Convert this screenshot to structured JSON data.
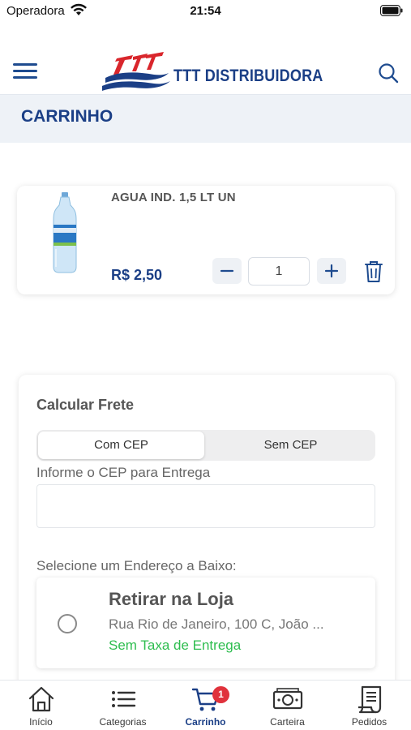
{
  "status_bar": {
    "carrier": "Operadora",
    "time": "21:54"
  },
  "header": {
    "brand": "TTT DISTRIBUIDORA",
    "logo_icon": "ttt-logo-icon",
    "menu_icon": "hamburger-menu-icon",
    "search_icon": "search-icon"
  },
  "page": {
    "title": "CARRINHO"
  },
  "cart": {
    "items": [
      {
        "name": "AGUA IND. 1,5 LT UN",
        "price": "R$ 2,50",
        "quantity": "1"
      }
    ]
  },
  "shipping": {
    "title": "Calcular Frete",
    "tabs": [
      "Com CEP",
      "Sem CEP"
    ],
    "selected_tab": "Com CEP",
    "cep_label": "Informe o CEP para Entrega",
    "cep_value": "",
    "address_label": "Selecione um Endereço a Baixo:",
    "address_option": {
      "title": "Retirar na Loja",
      "street": "Rua Rio de Janeiro, 100 C, João ...",
      "fee": "Sem Taxa de Entrega"
    }
  },
  "tabbar": {
    "items": [
      {
        "label": "Início",
        "icon": "home-icon"
      },
      {
        "label": "Categorias",
        "icon": "list-icon"
      },
      {
        "label": "Carrinho",
        "icon": "cart-icon",
        "badge": "1"
      },
      {
        "label": "Carteira",
        "icon": "wallet-icon"
      },
      {
        "label": "Pedidos",
        "icon": "receipt-icon"
      }
    ],
    "active": "Carrinho"
  },
  "colors": {
    "brand_blue": "#1b3f86",
    "accent_red": "#e0323c",
    "fee_green": "#2ebd4f",
    "band_bg": "#eef2f7"
  }
}
